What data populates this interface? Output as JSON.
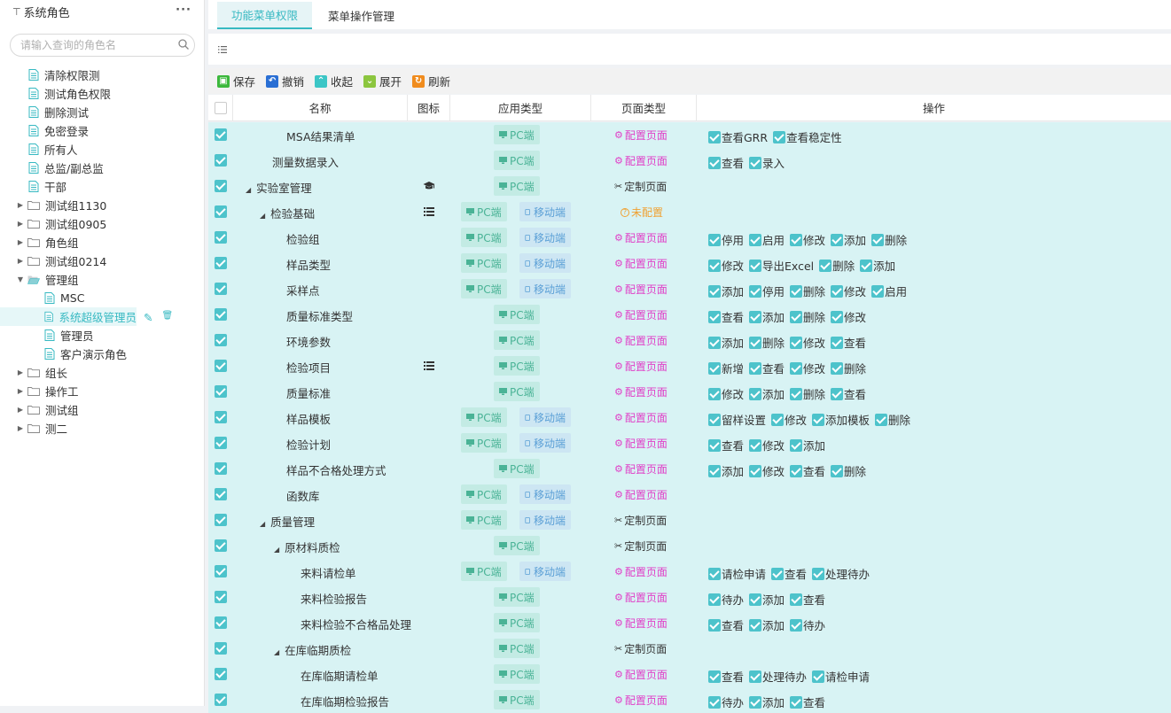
{
  "sidebar": {
    "title": "系统角色",
    "more": "···",
    "search_placeholder": "请输入查询的角色名",
    "items": [
      {
        "label": "清除权限测",
        "type": "doc",
        "level": 0
      },
      {
        "label": "测试角色权限",
        "type": "doc",
        "level": 0
      },
      {
        "label": "删除测试",
        "type": "doc",
        "level": 0
      },
      {
        "label": "免密登录",
        "type": "doc",
        "level": 0
      },
      {
        "label": "所有人",
        "type": "doc",
        "level": 0
      },
      {
        "label": "总监/副总监",
        "type": "doc",
        "level": 0
      },
      {
        "label": "干部",
        "type": "doc",
        "level": 0
      },
      {
        "label": "测试组1130",
        "type": "folder",
        "level": 0
      },
      {
        "label": "测试组0905",
        "type": "folder",
        "level": 0
      },
      {
        "label": "角色组",
        "type": "folder",
        "level": 0
      },
      {
        "label": "测试组0214",
        "type": "folder",
        "level": 0
      },
      {
        "label": "管理组",
        "type": "folder-open",
        "level": 0
      },
      {
        "label": "MSC",
        "type": "doc",
        "level": 1
      },
      {
        "label": "系统超级管理员",
        "type": "doc",
        "level": 1,
        "selected": true
      },
      {
        "label": "管理员",
        "type": "doc",
        "level": 1
      },
      {
        "label": "客户演示角色",
        "type": "doc",
        "level": 1
      },
      {
        "label": "组长",
        "type": "folder",
        "level": 0
      },
      {
        "label": "操作工",
        "type": "folder",
        "level": 0
      },
      {
        "label": "测试组",
        "type": "folder",
        "level": 0
      },
      {
        "label": "测二",
        "type": "folder",
        "level": 0
      }
    ]
  },
  "tabs": [
    "功能菜单权限",
    "菜单操作管理"
  ],
  "toolbar": {
    "save": "保存",
    "undo": "撤销",
    "collapse": "收起",
    "expand": "展开",
    "refresh": "刷新"
  },
  "columns": {
    "name": "名称",
    "icon": "图标",
    "app_type": "应用类型",
    "page_type": "页面类型",
    "ops": "操作"
  },
  "labels": {
    "pc": "PC端",
    "mobile": "移动端",
    "cfg": "配置页面",
    "custom": "定制页面",
    "none": "未配置"
  },
  "rows": [
    {
      "name": "MSA结果清单",
      "level": 2,
      "pc": true,
      "mobile": false,
      "page": "cfg",
      "ops": [
        "查看GRR",
        "查看稳定性"
      ]
    },
    {
      "name": "测量数据录入",
      "level": 1,
      "pc": true,
      "mobile": false,
      "page": "cfg",
      "ops": [
        "查看",
        "录入"
      ]
    },
    {
      "name": "实验室管理",
      "level": 0,
      "expanded": true,
      "icon": "graduation-cap-icon",
      "pc": true,
      "mobile": false,
      "page": "custom",
      "ops": []
    },
    {
      "name": "检验基础",
      "level": 1,
      "expanded": true,
      "icon": "list-icon",
      "pc": true,
      "mobile": true,
      "page": "none",
      "ops": []
    },
    {
      "name": "检验组",
      "level": 2,
      "pc": true,
      "mobile": true,
      "page": "cfg",
      "ops": [
        "停用",
        "启用",
        "修改",
        "添加",
        "删除"
      ]
    },
    {
      "name": "样品类型",
      "level": 2,
      "pc": true,
      "mobile": true,
      "page": "cfg",
      "ops": [
        "修改",
        "导出Excel",
        "删除",
        "添加"
      ]
    },
    {
      "name": "采样点",
      "level": 2,
      "pc": true,
      "mobile": true,
      "page": "cfg",
      "ops": [
        "添加",
        "停用",
        "删除",
        "修改",
        "启用"
      ]
    },
    {
      "name": "质量标准类型",
      "level": 2,
      "pc": true,
      "mobile": false,
      "page": "cfg",
      "ops": [
        "查看",
        "添加",
        "删除",
        "修改"
      ]
    },
    {
      "name": "环境参数",
      "level": 2,
      "pc": true,
      "mobile": false,
      "page": "cfg",
      "ops": [
        "添加",
        "删除",
        "修改",
        "查看"
      ]
    },
    {
      "name": "检验项目",
      "level": 2,
      "icon": "list-icon",
      "pc": true,
      "mobile": false,
      "page": "cfg",
      "ops": [
        "新增",
        "查看",
        "修改",
        "删除"
      ]
    },
    {
      "name": "质量标准",
      "level": 2,
      "pc": true,
      "mobile": false,
      "page": "cfg",
      "ops": [
        "修改",
        "添加",
        "删除",
        "查看"
      ]
    },
    {
      "name": "样品模板",
      "level": 2,
      "pc": true,
      "mobile": true,
      "page": "cfg",
      "ops": [
        "留样设置",
        "修改",
        "添加模板",
        "删除"
      ]
    },
    {
      "name": "检验计划",
      "level": 2,
      "pc": true,
      "mobile": true,
      "page": "cfg",
      "ops": [
        "查看",
        "修改",
        "添加"
      ]
    },
    {
      "name": "样品不合格处理方式",
      "level": 2,
      "pc": true,
      "mobile": false,
      "page": "cfg",
      "ops": [
        "添加",
        "修改",
        "查看",
        "删除"
      ]
    },
    {
      "name": "函数库",
      "level": 2,
      "pc": true,
      "mobile": true,
      "page": "cfg",
      "ops": []
    },
    {
      "name": "质量管理",
      "level": 1,
      "expanded": true,
      "pc": true,
      "mobile": true,
      "page": "custom",
      "ops": []
    },
    {
      "name": "原材料质检",
      "level": 2,
      "expanded": true,
      "pc": true,
      "mobile": false,
      "page": "custom",
      "ops": []
    },
    {
      "name": "来料请检单",
      "level": 3,
      "pc": true,
      "mobile": true,
      "page": "cfg",
      "ops": [
        "请检申请",
        "查看",
        "处理待办"
      ]
    },
    {
      "name": "来料检验报告",
      "level": 3,
      "pc": true,
      "mobile": false,
      "page": "cfg",
      "ops": [
        "待办",
        "添加",
        "查看"
      ]
    },
    {
      "name": "来料检验不合格品处理",
      "level": 3,
      "pc": true,
      "mobile": false,
      "page": "cfg",
      "ops": [
        "查看",
        "添加",
        "待办"
      ]
    },
    {
      "name": "在库临期质检",
      "level": 2,
      "expanded": true,
      "pc": true,
      "mobile": false,
      "page": "custom",
      "ops": []
    },
    {
      "name": "在库临期请检单",
      "level": 3,
      "pc": true,
      "mobile": false,
      "page": "cfg",
      "ops": [
        "查看",
        "处理待办",
        "请检申请"
      ]
    },
    {
      "name": "在库临期检验报告",
      "level": 3,
      "pc": true,
      "mobile": false,
      "page": "cfg",
      "ops": [
        "待办",
        "添加",
        "查看"
      ]
    }
  ]
}
